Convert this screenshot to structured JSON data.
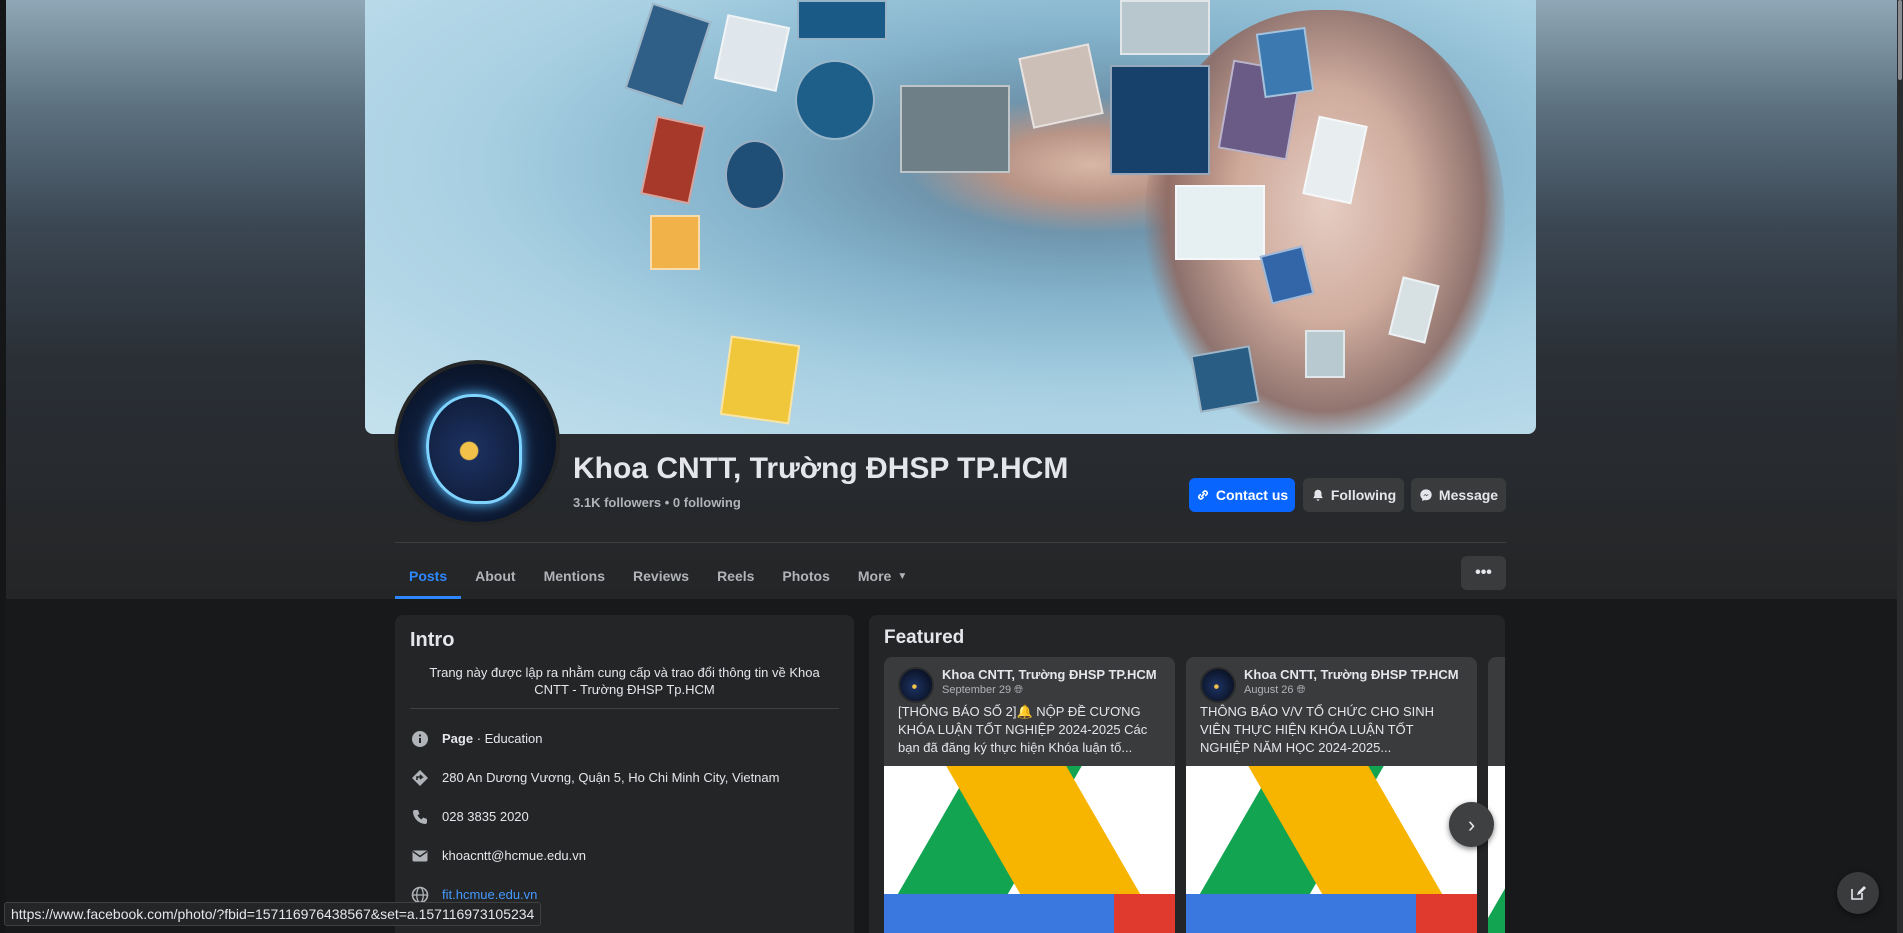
{
  "profile": {
    "name": "Khoa CNTT, Trường ĐHSP TP.HCM",
    "follow_meta": "3.1K followers • 0 following"
  },
  "actions": {
    "contact_label": "Contact us",
    "following_label": "Following",
    "message_label": "Message"
  },
  "tabs": [
    {
      "label": "Posts",
      "active": true
    },
    {
      "label": "About"
    },
    {
      "label": "Mentions"
    },
    {
      "label": "Reviews"
    },
    {
      "label": "Reels"
    },
    {
      "label": "Photos"
    },
    {
      "label": "More"
    }
  ],
  "intro": {
    "title": "Intro",
    "description": "Trang này được lập ra nhằm cung cấp và trao đổi thông tin về Khoa CNTT - Trường ĐHSP Tp.HCM",
    "page_label": "Page",
    "category": " · Education",
    "address": "280 An Dương Vương, Quận 5, Ho Chi Minh City, Vietnam",
    "phone": "028 3835 2020",
    "email": "khoacntt@hcmue.edu.vn",
    "website": "fit.hcmue.edu.vn"
  },
  "featured": {
    "title": "Featured",
    "items": [
      {
        "author": "Khoa CNTT, Trường ĐHSP TP.HCM",
        "date": "September 29",
        "text": "[THÔNG BÁO SỐ 2]🔔 NỘP ĐỀ CƯƠNG KHÓA LUẬN TỐT NGHIỆP 2024-2025 Các bạn đã đăng ký thực hiện Khóa luận tố..."
      },
      {
        "author": "Khoa CNTT, Trường ĐHSP TP.HCM",
        "date": "August 26",
        "text": "THÔNG BÁO V/V TỔ CHỨC CHO SINH VIÊN THỰC HIỆN KHÓA LUẬN TỐT NGHIỆP NĂM HỌC 2024-2025..."
      }
    ]
  },
  "status_bar": {
    "url": "https://www.facebook.com/photo/?fbid=157116976438567&set=a.157116973105234"
  },
  "icons": {
    "contact": "link-icon",
    "following": "bell-icon",
    "message": "messenger-icon",
    "more": "caret-down-icon",
    "page_options": "ellipsis-icon",
    "info": "info-icon",
    "address": "location-icon",
    "phone": "phone-icon",
    "email": "mail-icon",
    "website": "globe-icon",
    "next": "chevron-right-icon",
    "compose": "compose-icon"
  },
  "colors": {
    "accent": "#0866ff",
    "active_tab": "#2d88ff",
    "background": "#18191a",
    "card": "#242526"
  }
}
